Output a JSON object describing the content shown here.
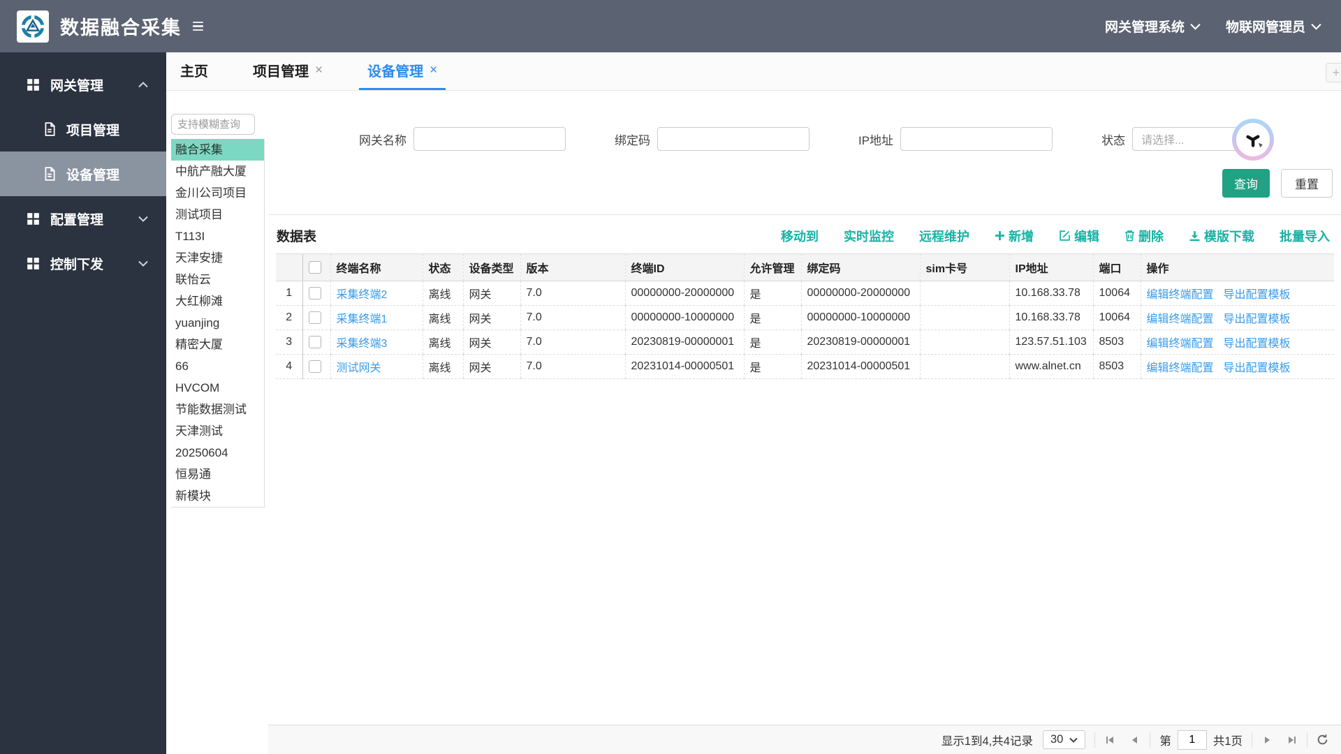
{
  "header": {
    "app_title": "数据融合采集",
    "system_dropdown": "网关管理系统",
    "user_dropdown": "物联网管理员"
  },
  "sidebar": {
    "sections": [
      {
        "name": "gateway-management",
        "label": "网关管理",
        "expanded": true,
        "children": [
          {
            "name": "project-management",
            "label": "项目管理",
            "active": false
          },
          {
            "name": "device-management",
            "label": "设备管理",
            "active": true
          }
        ]
      },
      {
        "name": "config-management",
        "label": "配置管理",
        "expanded": false,
        "children": []
      },
      {
        "name": "control-dispatch",
        "label": "控制下发",
        "expanded": false,
        "children": []
      }
    ]
  },
  "tabs": [
    {
      "name": "tab-home",
      "label": "主页",
      "closable": false,
      "active": false
    },
    {
      "name": "tab-project-management",
      "label": "项目管理",
      "closable": true,
      "active": false
    },
    {
      "name": "tab-device-management",
      "label": "设备管理",
      "closable": true,
      "active": true
    }
  ],
  "project_panel": {
    "search_placeholder": "支持模糊查询",
    "active_item": "融合采集",
    "items": [
      "融合采集",
      "中航产融大厦",
      "金川公司项目",
      "测试项目",
      "T113I",
      "天津安捷",
      "联怡云",
      "大红柳滩",
      "yuanjing",
      "精密大厦",
      "66",
      "HVCOM",
      "节能数据测试",
      "天津测试",
      "20250604",
      "恒易通",
      "新模块"
    ]
  },
  "filters": {
    "gateway_name_label": "网关名称",
    "bind_code_label": "绑定码",
    "ip_label": "IP地址",
    "status_label": "状态",
    "status_placeholder": "请选择...",
    "query_button": "查询",
    "reset_button": "重置"
  },
  "table": {
    "title": "数据表",
    "toolbar": [
      {
        "name": "move-to",
        "label": "移动到",
        "icon": ""
      },
      {
        "name": "realtime-monitor",
        "label": "实时监控",
        "icon": ""
      },
      {
        "name": "remote-maintenance",
        "label": "远程维护",
        "icon": ""
      },
      {
        "name": "add",
        "label": "新增",
        "icon": "plus"
      },
      {
        "name": "edit",
        "label": "编辑",
        "icon": "edit"
      },
      {
        "name": "delete",
        "label": "删除",
        "icon": "trash"
      },
      {
        "name": "template-download",
        "label": "模版下载",
        "icon": "download"
      },
      {
        "name": "batch-import",
        "label": "批量导入",
        "icon": ""
      }
    ],
    "columns": [
      "终端名称",
      "状态",
      "设备类型",
      "版本",
      "终端ID",
      "允许管理",
      "绑定码",
      "sim卡号",
      "IP地址",
      "端口",
      "操作"
    ],
    "rows": [
      {
        "index": "1",
        "name": "采集终端2",
        "status": "离线",
        "device_type": "网关",
        "version": "7.0",
        "terminal_id": "00000000-20000000",
        "allow_manage": "是",
        "bind_code": "00000000-20000000",
        "sim": "",
        "ip": "10.168.33.78",
        "port": "10064"
      },
      {
        "index": "2",
        "name": "采集终端1",
        "status": "离线",
        "device_type": "网关",
        "version": "7.0",
        "terminal_id": "00000000-10000000",
        "allow_manage": "是",
        "bind_code": "00000000-10000000",
        "sim": "",
        "ip": "10.168.33.78",
        "port": "10064"
      },
      {
        "index": "3",
        "name": "采集终端3",
        "status": "离线",
        "device_type": "网关",
        "version": "7.0",
        "terminal_id": "20230819-00000001",
        "allow_manage": "是",
        "bind_code": "20230819-00000001",
        "sim": "",
        "ip": "123.57.51.103",
        "port": "8503"
      },
      {
        "index": "4",
        "name": "测试网关",
        "status": "离线",
        "device_type": "网关",
        "version": "7.0",
        "terminal_id": "20231014-00000501",
        "allow_manage": "是",
        "bind_code": "20231014-00000501",
        "sim": "",
        "ip": "www.alnet.cn",
        "port": "8503"
      }
    ],
    "row_actions": [
      "编辑终端配置",
      "导出配置模板"
    ]
  },
  "pagination": {
    "summary": "显示1到4,共4记录",
    "page_size": "30",
    "page_prefix": "第",
    "current_page": "1",
    "total_pages_label": "共1页"
  },
  "colors": {
    "header_bg": "#5b6271",
    "sidebar_bg": "#2b3340",
    "sidebar_active_bg": "#8a93a0",
    "accent_teal": "#17b3a4",
    "active_project_bg": "#7dd8c3",
    "tab_active_blue": "#2d8cf0",
    "link_blue": "#3a9be8",
    "query_button_green": "#20a283"
  }
}
